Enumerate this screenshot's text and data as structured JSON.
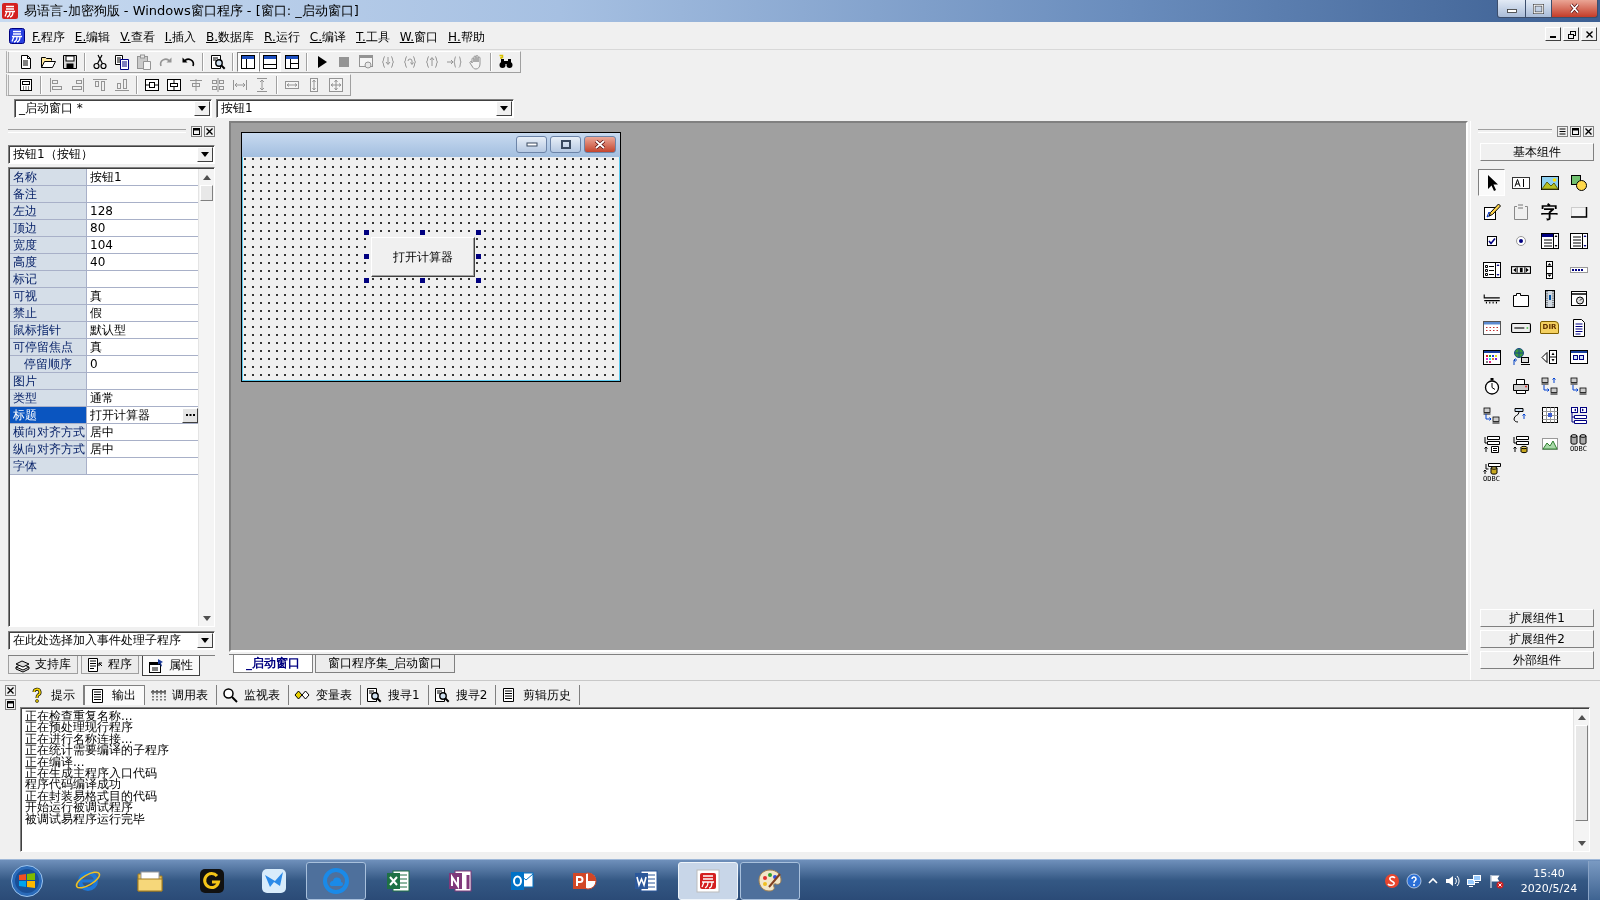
{
  "window": {
    "title": "易语言-加密狗版 - Windows窗口程序 - [窗口: _启动窗口]"
  },
  "menu": [
    {
      "label": "F.程序"
    },
    {
      "label": "E.编辑"
    },
    {
      "label": "V.查看"
    },
    {
      "label": "I.插入"
    },
    {
      "label": "B.数据库"
    },
    {
      "label": "R.运行"
    },
    {
      "label": "C.编译"
    },
    {
      "label": "T.工具"
    },
    {
      "label": "W.窗口"
    },
    {
      "label": "H.帮助"
    }
  ],
  "toolbar_main": [
    [
      {
        "kind": "new",
        "disabled": false
      },
      {
        "kind": "open",
        "disabled": false
      },
      {
        "kind": "save",
        "disabled": false
      }
    ],
    [
      {
        "kind": "cut",
        "disabled": false
      },
      {
        "kind": "copy",
        "disabled": false
      },
      {
        "kind": "paste",
        "disabled": true
      },
      {
        "kind": "redo",
        "disabled": true
      },
      {
        "kind": "undo",
        "disabled": false
      }
    ],
    [
      {
        "kind": "preview",
        "disabled": false
      }
    ],
    [
      {
        "kind": "layout_a",
        "disabled": false,
        "pressed": true
      },
      {
        "kind": "layout_b",
        "disabled": false,
        "pressed": true
      },
      {
        "kind": "layout_c",
        "disabled": false,
        "pressed": false
      }
    ],
    [
      {
        "kind": "run",
        "disabled": false
      },
      {
        "kind": "stop",
        "disabled": true
      },
      {
        "kind": "debug_window",
        "disabled": true
      },
      {
        "kind": "step_into",
        "disabled": true
      },
      {
        "kind": "step_over",
        "disabled": true
      },
      {
        "kind": "step_out",
        "disabled": true
      },
      {
        "kind": "run_to",
        "disabled": true
      },
      {
        "kind": "hand",
        "disabled": true
      }
    ],
    [
      {
        "kind": "binoculars",
        "disabled": false
      }
    ]
  ],
  "toolbar_layout": [
    [
      {
        "kind": "form_grid",
        "disabled": false
      }
    ],
    [
      {
        "kind": "align_left",
        "disabled": true
      },
      {
        "kind": "align_right",
        "disabled": true
      },
      {
        "kind": "align_top",
        "disabled": true
      },
      {
        "kind": "align_bottom",
        "disabled": true
      }
    ],
    [
      {
        "kind": "center_h",
        "disabled": false
      },
      {
        "kind": "center_v",
        "disabled": false
      },
      {
        "kind": "stack_top",
        "disabled": true
      },
      {
        "kind": "stack_mid",
        "disabled": true
      },
      {
        "kind": "space_h",
        "disabled": true
      },
      {
        "kind": "space_v",
        "disabled": true
      }
    ],
    [
      {
        "kind": "size_w",
        "disabled": true
      },
      {
        "kind": "size_h",
        "disabled": true
      },
      {
        "kind": "size_both",
        "disabled": true
      }
    ]
  ],
  "selectors": [
    {
      "value": "_启动窗口 *"
    },
    {
      "value": "按钮1"
    }
  ],
  "properties_panel": {
    "object": "按钮1（按钮）",
    "properties": [
      {
        "name": "名称",
        "value": "按钮1",
        "selected": false
      },
      {
        "name": "备注",
        "selected": false
      },
      {
        "name": "左边",
        "value": "128",
        "selected": false
      },
      {
        "name": "顶边",
        "value": "80",
        "selected": false
      },
      {
        "name": "宽度",
        "value": "104",
        "selected": false
      },
      {
        "name": "高度",
        "value": "40",
        "selected": false
      },
      {
        "name": "标记",
        "selected": false
      },
      {
        "name": "可视",
        "value": "真",
        "selected": false
      },
      {
        "name": "禁止",
        "value": "假",
        "selected": false
      },
      {
        "name": "鼠标指针",
        "value": "默认型",
        "selected": false
      },
      {
        "name": "可停留焦点",
        "value": "真",
        "selected": false,
        "children": [
          {
            "name": "停留顺序",
            "value": "0",
            "selected": false
          }
        ]
      },
      {
        "name": "图片",
        "selected": false
      },
      {
        "name": "类型",
        "value": "通常",
        "selected": false
      },
      {
        "name": "标题",
        "value": "打开计算器",
        "selected": true
      },
      {
        "name": "横向对齐方式",
        "value": "居中",
        "selected": false
      },
      {
        "name": "纵向对齐方式",
        "value": "居中",
        "selected": false
      },
      {
        "name": "字体",
        "selected": false
      }
    ],
    "event": "在此处选择加入事件处理子程序",
    "tabs": [
      {
        "label": "支持库",
        "kind": "library",
        "selected": false
      },
      {
        "label": "程序",
        "kind": "program",
        "selected": false
      },
      {
        "label": "属性",
        "kind": "properties",
        "selected": true
      }
    ]
  },
  "designer": {
    "controls": [
      {
        "caption": "打开计算器",
        "selected": true
      }
    ],
    "tabs": [
      {
        "label": "_启动窗口",
        "selected": true
      },
      {
        "label": "窗口程序集_启动窗口",
        "selected": false
      }
    ]
  },
  "toolbox": {
    "title": "基本组件",
    "items": [
      {
        "kind": "pointer",
        "selected": true
      },
      {
        "kind": "label",
        "selected": false
      },
      {
        "kind": "picture",
        "selected": false
      },
      {
        "kind": "shape",
        "selected": false
      },
      {
        "kind": "edit",
        "selected": false
      },
      {
        "kind": "groupbox",
        "selected": false
      },
      {
        "kind": "glyph",
        "text": "字",
        "selected": false
      },
      {
        "kind": "button",
        "selected": false
      },
      {
        "kind": "checkbox",
        "selected": false
      },
      {
        "kind": "radio",
        "selected": false
      },
      {
        "kind": "combobox",
        "selected": false
      },
      {
        "kind": "listbox",
        "selected": false
      },
      {
        "kind": "checklist",
        "selected": false
      },
      {
        "kind": "hscroll",
        "selected": false
      },
      {
        "kind": "vscroll",
        "selected": false
      },
      {
        "kind": "progress",
        "selected": false
      },
      {
        "kind": "slider",
        "selected": false
      },
      {
        "kind": "tabs",
        "selected": false
      },
      {
        "kind": "video",
        "selected": false
      },
      {
        "kind": "browser_window",
        "selected": false
      },
      {
        "kind": "calendar",
        "selected": false
      },
      {
        "kind": "drive_box",
        "selected": false
      },
      {
        "kind": "dir_box",
        "text": "DIR",
        "selected": false
      },
      {
        "kind": "file_box",
        "selected": false
      },
      {
        "kind": "color_picker",
        "selected": false
      },
      {
        "kind": "hyperlink",
        "selected": false
      },
      {
        "kind": "spinner",
        "selected": false
      },
      {
        "kind": "toolbar_box",
        "selected": false
      },
      {
        "kind": "timer",
        "selected": false
      },
      {
        "kind": "printer",
        "selected": false
      },
      {
        "kind": "client_server",
        "selected": false
      },
      {
        "kind": "server",
        "selected": false
      },
      {
        "kind": "client",
        "selected": false
      },
      {
        "kind": "serial",
        "selected": false
      },
      {
        "kind": "table",
        "selected": false
      },
      {
        "kind": "navigator",
        "selected": false
      },
      {
        "kind": "data_source",
        "selected": false
      },
      {
        "kind": "db_source",
        "selected": false
      },
      {
        "kind": "chart",
        "selected": false
      },
      {
        "kind": "odbc_db",
        "text": "ODBC",
        "selected": false
      },
      {
        "kind": "odbc_source",
        "text": "ODBC",
        "selected": false
      }
    ],
    "groups": [
      {
        "label": "扩展组件1"
      },
      {
        "label": "扩展组件2"
      },
      {
        "label": "外部组件"
      }
    ]
  },
  "output_panel": {
    "tabs": [
      {
        "label": "提示",
        "kind": "hint",
        "selected": false
      },
      {
        "label": "输出",
        "kind": "output",
        "selected": true
      },
      {
        "label": "调用表",
        "kind": "calls",
        "selected": false
      },
      {
        "label": "监视表",
        "kind": "watch",
        "selected": false
      },
      {
        "label": "变量表",
        "kind": "variables",
        "selected": false
      },
      {
        "label": "搜寻1",
        "kind": "search",
        "selected": false
      },
      {
        "label": "搜寻2",
        "kind": "search",
        "selected": false
      },
      {
        "label": "剪辑历史",
        "kind": "clips",
        "selected": false
      }
    ],
    "lines": [
      "正在检查重复名称...",
      "正在预处理现行程序",
      "正在进行名称连接...",
      "正在统计需要编译的子程序",
      "正在编译...",
      "正在生成主程序入口代码",
      "程序代码编译成功",
      "正在封装易格式目的代码",
      "开始运行被调试程序",
      "被调试易程序运行完毕"
    ]
  },
  "taskbar": {
    "apps": [
      {
        "kind": "browser",
        "open": false,
        "selected": false
      },
      {
        "kind": "files",
        "open": false,
        "selected": false
      },
      {
        "kind": "ring_app",
        "open": false,
        "selected": false
      },
      {
        "kind": "bird_app",
        "open": false,
        "selected": false
      },
      {
        "kind": "cloud_app",
        "open": true,
        "selected": false
      },
      {
        "kind": "sheet",
        "open": false,
        "selected": false
      },
      {
        "kind": "notebook",
        "open": false,
        "selected": false
      },
      {
        "kind": "mail",
        "open": false,
        "selected": false
      },
      {
        "kind": "slides",
        "open": false,
        "selected": false
      },
      {
        "kind": "docs",
        "open": false,
        "selected": false
      },
      {
        "kind": "ide",
        "open": true,
        "selected": true
      },
      {
        "kind": "paint",
        "open": true,
        "selected": false
      }
    ],
    "time": "15:40",
    "date": "2020/5/24"
  }
}
